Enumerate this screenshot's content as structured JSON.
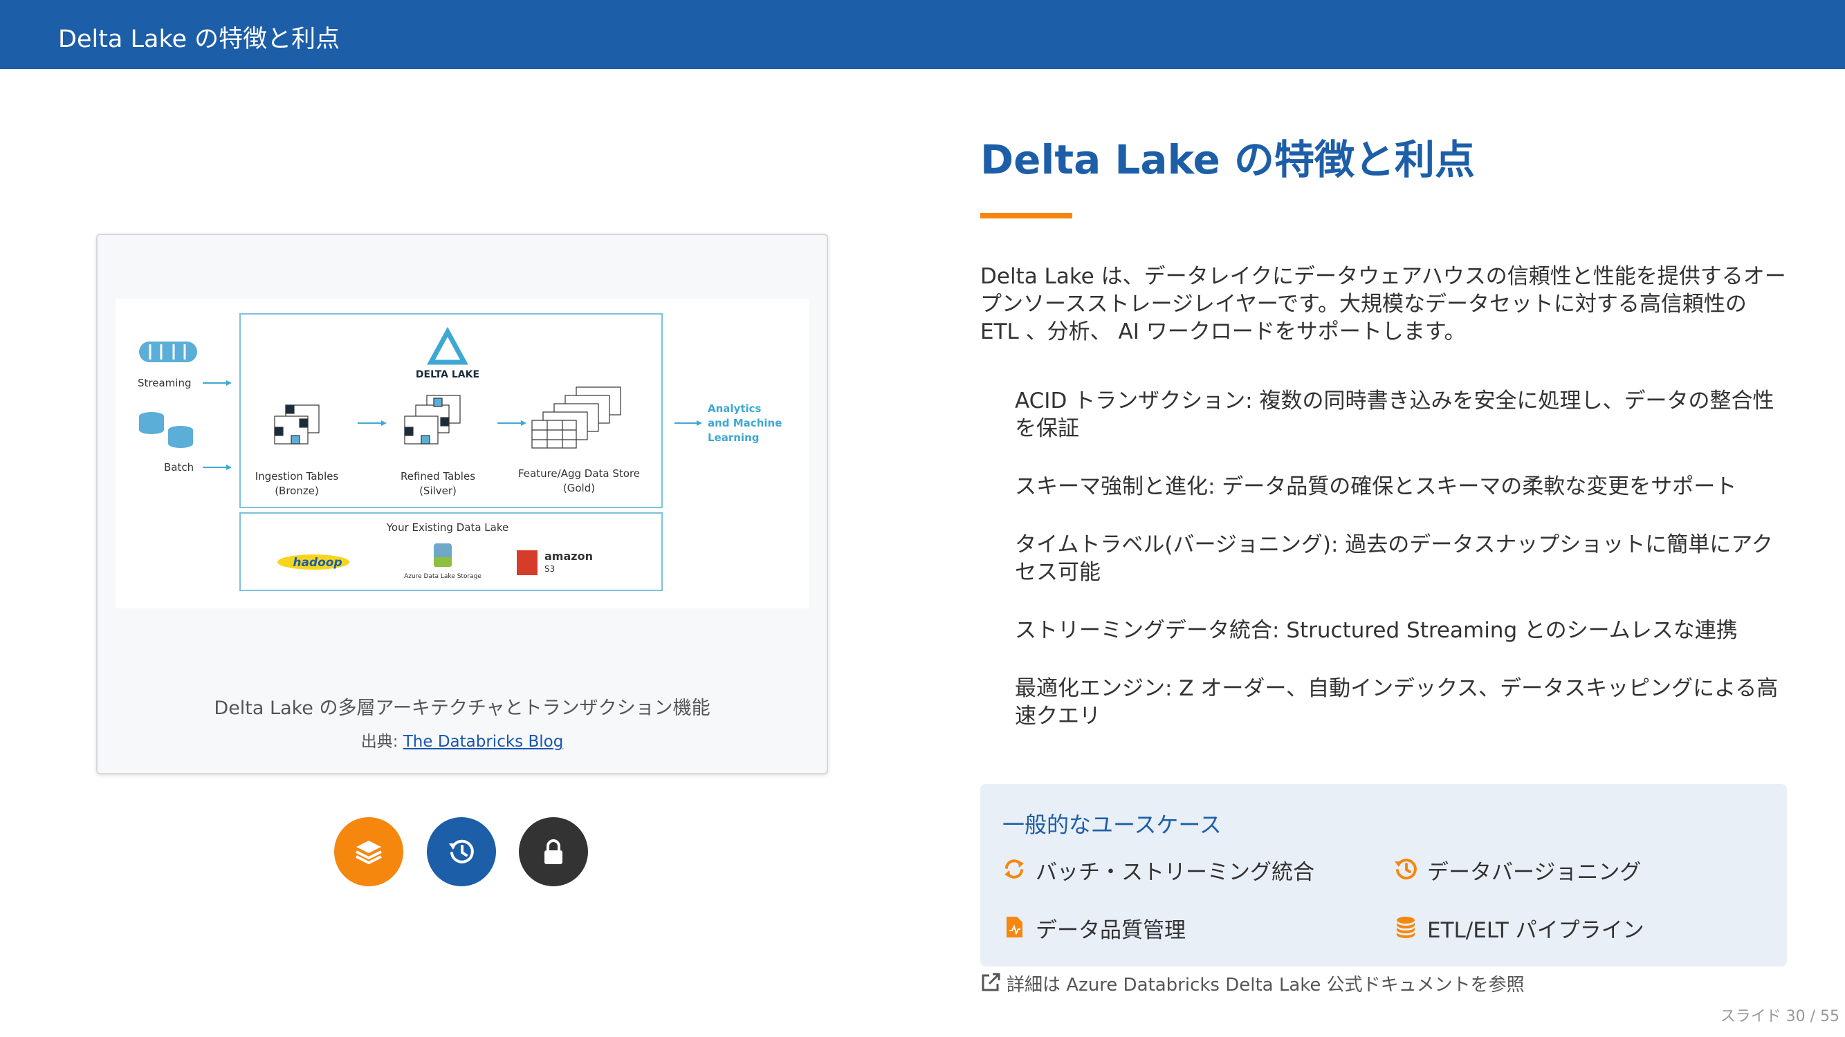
{
  "header": {
    "title": "Delta Lake の特徴と利点"
  },
  "figure": {
    "caption": "Delta Lake の多層アーキテクチャとトランザクション機能",
    "source_prefix": "出典:",
    "source_link": "The Databricks Blog",
    "diagram": {
      "inputs": [
        "Streaming",
        "Batch"
      ],
      "logo": "DELTA LAKE",
      "tables": [
        {
          "name": "Ingestion Tables",
          "tier": "(Bronze)"
        },
        {
          "name": "Refined Tables",
          "tier": "(Silver)"
        },
        {
          "name": "Feature/Agg Data Store",
          "tier": "(Gold)"
        }
      ],
      "output": [
        "Analytics",
        "and Machine",
        "Learning"
      ],
      "storage_title": "Your Existing Data Lake",
      "storage": [
        "hadoop",
        "Azure Data Lake Storage",
        "amazon",
        "S3"
      ]
    }
  },
  "action_icons": [
    "layers-icon",
    "history-icon",
    "lock-icon"
  ],
  "colors": {
    "primary": "#1d5ea8",
    "accent": "#f5870f",
    "dark": "#333333",
    "panel": "#e9eff7"
  },
  "main": {
    "title": "Delta Lake の特徴と利点",
    "intro": "Delta Lake は、データレイクにデータウェアハウスの信頼性と性能を提供するオープンソースストレージレイヤーです。大規模なデータセットに対する高信頼性の ETL 、分析、 AI ワークロードをサポートします。",
    "features": [
      "ACID トランザクション: 複数の同時書き込みを安全に処理し、データの整合性を保証",
      "スキーマ強制と進化: データ品質の確保とスキーマの柔軟な変更をサポート",
      "タイムトラベル(バージョニング): 過去のデータスナップショットに簡単にアクセス可能",
      "ストリーミングデータ統合: Structured Streaming とのシームレスな連携",
      "最適化エンジン: Z オーダー、自動インデックス、データスキッピングによる高速クエリ"
    ]
  },
  "usecases": {
    "title": "一般的なユースケース",
    "items": [
      {
        "label": "バッチ・ストリーミング統合",
        "icon": "sync-icon"
      },
      {
        "label": "データバージョニング",
        "icon": "history-icon"
      },
      {
        "label": "データ品質管理",
        "icon": "file-chart-icon"
      },
      {
        "label": "ETL/ELT パイプライン",
        "icon": "database-icon"
      }
    ]
  },
  "footer": {
    "doc_link": "詳細は Azure Databricks Delta Lake 公式ドキュメントを参照",
    "slide_number": "スライド 30 / 55"
  }
}
